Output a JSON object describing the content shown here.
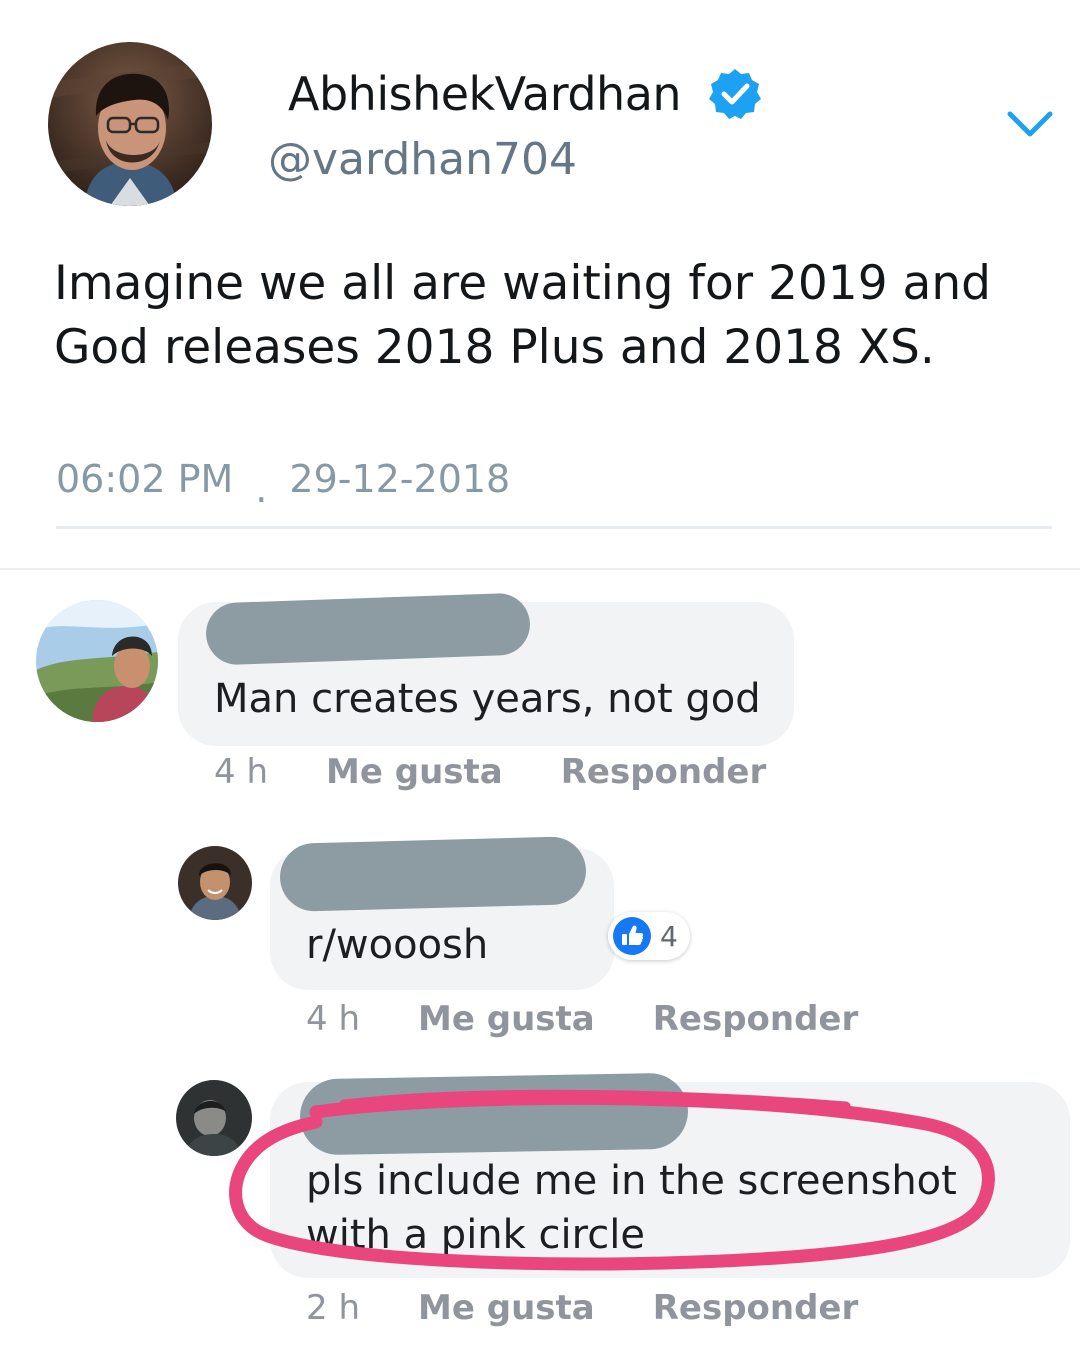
{
  "tweet": {
    "display_name": "AbhishekVardhan",
    "handle": "@vardhan704",
    "verified": true,
    "text": "Imagine we all are waiting for 2019 and God releases 2018 Plus and 2018 XS.",
    "time": "06:02 PM",
    "date": "29-12-2018",
    "colors": {
      "verified": "#1da1f2",
      "chevron": "#1da1f2",
      "meta": "#8899a6"
    }
  },
  "comments": [
    {
      "text": "Man creates years, not god",
      "time": "4 h",
      "like_label": "Me gusta",
      "reply_label": "Responder",
      "name_redacted": true
    },
    {
      "text": "r/wooosh",
      "time": "4 h",
      "like_label": "Me gusta",
      "reply_label": "Responder",
      "reaction_count": "4",
      "reaction_icon": "thumbs-up-icon",
      "name_redacted": true
    },
    {
      "text_line1": "pls include me in the screenshot",
      "text_line2": "with a pink circle",
      "time": "2 h",
      "like_label": "Me gusta",
      "reply_label": "Responder",
      "name_redacted": true,
      "highlight_color": "#e8467c"
    }
  ],
  "colors": {
    "redaction": "#8d9ca3",
    "bubble": "#f2f3f5",
    "fb_blue": "#1877f2",
    "action_text": "#90949c"
  }
}
